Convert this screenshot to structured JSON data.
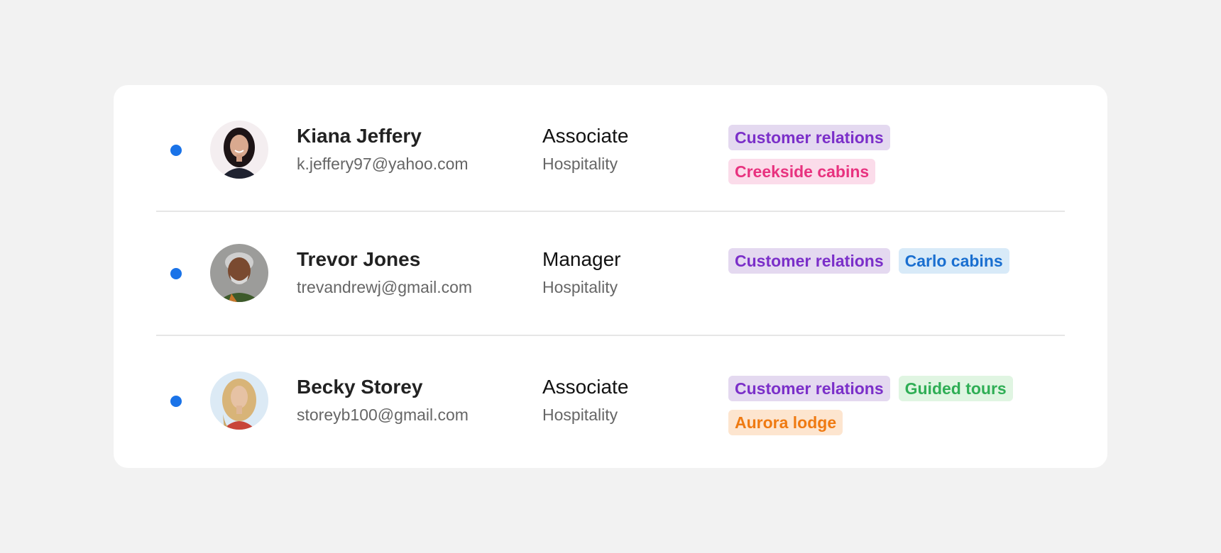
{
  "colors": {
    "background": "#f2f2f2",
    "card": "#ffffff",
    "status_dot": "#1a73e8",
    "divider": "#e6e6e6"
  },
  "team_list": {
    "members": [
      {
        "name": "Kiana Jeffery",
        "email": "k.jeffery97@yahoo.com",
        "role": "Associate",
        "department": "Hospitality",
        "avatar_icon": "avatar-photo-woman-dark-hair",
        "tags": [
          {
            "label": "Customer relations",
            "text_color": "#7b2fc9",
            "bg_color": "#e4d9f0"
          },
          {
            "label": "Creekside cabins",
            "text_color": "#e8327f",
            "bg_color": "#fbdcea"
          }
        ]
      },
      {
        "name": "Trevor Jones",
        "email": "trevandrewj@gmail.com",
        "role": "Manager",
        "department": "Hospitality",
        "avatar_icon": "avatar-photo-man-gray-hair",
        "tags": [
          {
            "label": "Customer relations",
            "text_color": "#7b2fc9",
            "bg_color": "#e4d9f0"
          },
          {
            "label": "Carlo cabins",
            "text_color": "#1a6fd0",
            "bg_color": "#d8eaf8"
          }
        ]
      },
      {
        "name": "Becky Storey",
        "email": "storeyb100@gmail.com",
        "role": "Associate",
        "department": "Hospitality",
        "avatar_icon": "avatar-photo-woman-blonde",
        "tags": [
          {
            "label": "Customer relations",
            "text_color": "#7b2fc9",
            "bg_color": "#e4d9f0"
          },
          {
            "label": "Guided tours",
            "text_color": "#2fae55",
            "bg_color": "#e0f5e2"
          },
          {
            "label": "Aurora lodge",
            "text_color": "#ef7a12",
            "bg_color": "#fde5cf"
          }
        ]
      }
    ]
  }
}
